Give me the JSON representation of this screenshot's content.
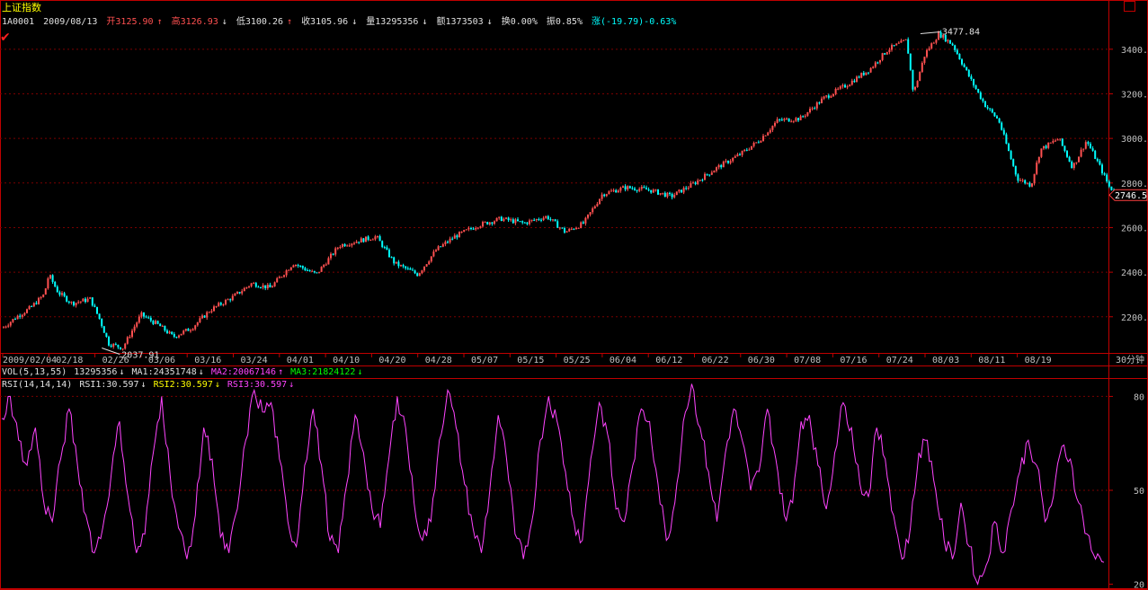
{
  "header": {
    "title": "上证指数",
    "code": "1A0001",
    "date": "2009/08/13",
    "open": "开3125.90",
    "high": "高3126.93",
    "low": "低3100.26",
    "close": "收3105.96",
    "volume": "量13295356",
    "amount": "额1373503",
    "turnover": "换0.00%",
    "amplitude": "振0.85%",
    "change": "涨(-19.79)-0.63%"
  },
  "volume_bar": {
    "label": "VOL(5,13,55)",
    "vol": "13295356",
    "ma1": "MA1:24351748",
    "ma2": "MA2:20067146",
    "ma3": "MA3:21824122"
  },
  "rsi_bar": {
    "label": "RSI(14,14,14)",
    "rsi1": "RSI1:30.597",
    "rsi2": "RSI2:30.597",
    "rsi3": "RSI3:30.597"
  },
  "period_label": "30分钟",
  "colors": {
    "up": "#ff5050",
    "down": "#00ffff",
    "grid": "#7a0000",
    "frame": "#c00000",
    "rsi": "#ff44ff",
    "current_tag": "#ff4040"
  },
  "chart_data": [
    {
      "type": "candlestick",
      "x_ticks": [
        "2009/02/04",
        "02/18",
        "02/26",
        "03/06",
        "03/16",
        "03/24",
        "04/01",
        "04/10",
        "04/20",
        "04/28",
        "05/07",
        "05/15",
        "05/25",
        "06/04",
        "06/12",
        "06/22",
        "06/30",
        "07/08",
        "07/16",
        "07/24",
        "08/03",
        "08/11",
        "08/19"
      ],
      "y_ticks": [
        2200.0,
        2400.0,
        2600.0,
        2800.0,
        3000.0,
        3200.0,
        3400.0
      ],
      "ylim": [
        2050,
        3500
      ],
      "min_annotation": {
        "value": "2037.91",
        "x_index": 2.15
      },
      "max_annotation": {
        "value": "3477.84",
        "x_index": 19.9
      },
      "current_value": "2746.5",
      "close_path": [
        [
          0,
          2150
        ],
        [
          0.3,
          2200
        ],
        [
          0.6,
          2240
        ],
        [
          0.9,
          2300
        ],
        [
          1.0,
          2390
        ],
        [
          1.2,
          2310
        ],
        [
          1.5,
          2260
        ],
        [
          1.9,
          2280
        ],
        [
          2.1,
          2190
        ],
        [
          2.3,
          2080
        ],
        [
          2.6,
          2060
        ],
        [
          3.0,
          2210
        ],
        [
          3.4,
          2160
        ],
        [
          3.7,
          2110
        ],
        [
          4.1,
          2150
        ],
        [
          4.5,
          2230
        ],
        [
          5.0,
          2290
        ],
        [
          5.4,
          2350
        ],
        [
          5.8,
          2330
        ],
        [
          6.3,
          2440
        ],
        [
          6.8,
          2390
        ],
        [
          7.3,
          2520
        ],
        [
          7.7,
          2540
        ],
        [
          8.1,
          2560
        ],
        [
          8.5,
          2440
        ],
        [
          9.0,
          2390
        ],
        [
          9.4,
          2500
        ],
        [
          9.8,
          2560
        ],
        [
          10.3,
          2610
        ],
        [
          10.8,
          2640
        ],
        [
          11.3,
          2620
        ],
        [
          11.8,
          2650
        ],
        [
          12.2,
          2580
        ],
        [
          12.6,
          2620
        ],
        [
          13.0,
          2750
        ],
        [
          13.5,
          2780
        ],
        [
          14.0,
          2770
        ],
        [
          14.5,
          2740
        ],
        [
          15.0,
          2800
        ],
        [
          15.5,
          2870
        ],
        [
          16.0,
          2930
        ],
        [
          16.4,
          2990
        ],
        [
          16.8,
          3080
        ],
        [
          17.3,
          3090
        ],
        [
          17.8,
          3180
        ],
        [
          18.3,
          3240
        ],
        [
          18.8,
          3310
        ],
        [
          19.2,
          3400
        ],
        [
          19.6,
          3440
        ],
        [
          19.75,
          3200
        ],
        [
          20.0,
          3380
        ],
        [
          20.3,
          3470
        ],
        [
          20.6,
          3420
        ],
        [
          21.0,
          3260
        ],
        [
          21.3,
          3150
        ],
        [
          21.6,
          3080
        ],
        [
          22.0,
          2820
        ],
        [
          22.3,
          2790
        ],
        [
          22.5,
          2950
        ],
        [
          22.9,
          3000
        ],
        [
          23.2,
          2870
        ],
        [
          23.5,
          2990
        ],
        [
          23.8,
          2870
        ],
        [
          24.0,
          2780
        ],
        [
          24.2,
          2746
        ]
      ]
    },
    {
      "type": "line",
      "name": "RSI3",
      "y_ticks": [
        20,
        50,
        80
      ],
      "ylim": [
        19,
        85
      ],
      "values": [
        73,
        80,
        66,
        58,
        70,
        46,
        40,
        60,
        76,
        58,
        42,
        30,
        38,
        55,
        72,
        48,
        30,
        36,
        62,
        80,
        55,
        38,
        28,
        42,
        70,
        60,
        35,
        30,
        44,
        66,
        82,
        75,
        78,
        60,
        40,
        32,
        58,
        76,
        58,
        34,
        30,
        52,
        74,
        62,
        44,
        38,
        60,
        80,
        70,
        46,
        34,
        40,
        66,
        82,
        70,
        52,
        38,
        30,
        50,
        74,
        60,
        36,
        28,
        40,
        66,
        80,
        72,
        56,
        40,
        34,
        60,
        78,
        68,
        44,
        40,
        58,
        76,
        72,
        52,
        34,
        46,
        72,
        84,
        70,
        56,
        40,
        62,
        76,
        66,
        50,
        56,
        76,
        60,
        42,
        46,
        72,
        74,
        58,
        44,
        62,
        78,
        70,
        52,
        48,
        70,
        60,
        42,
        28,
        38,
        62,
        66,
        50,
        34,
        28,
        46,
        32,
        20,
        26,
        40,
        30,
        44,
        56,
        66,
        58,
        40,
        48,
        64,
        60,
        46,
        36,
        28,
        27
      ]
    }
  ]
}
